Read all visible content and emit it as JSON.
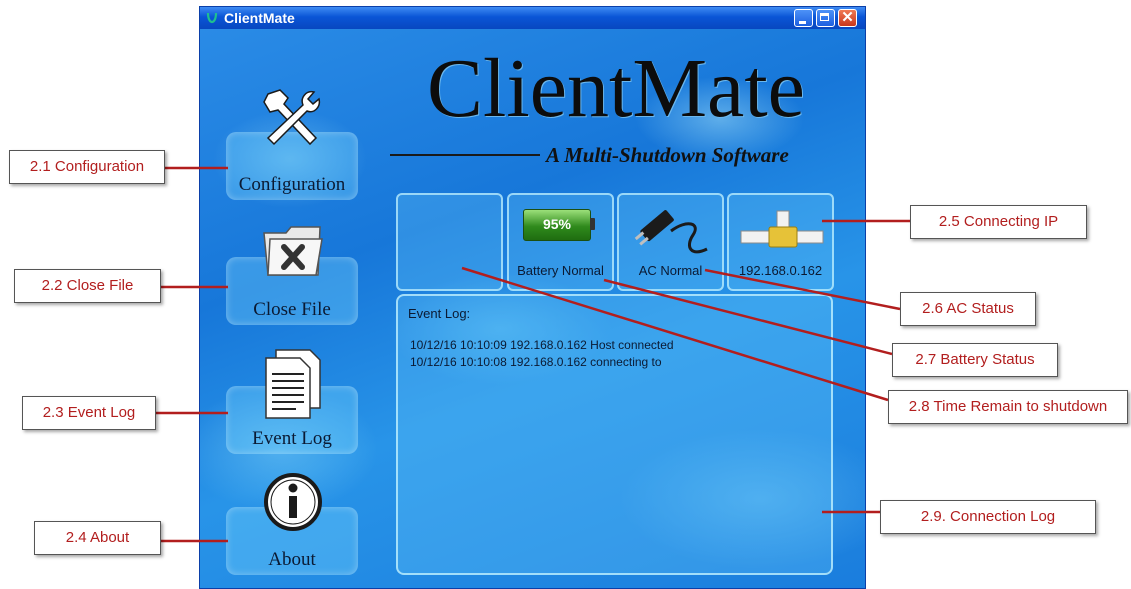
{
  "window": {
    "title": "ClientMate",
    "controls": {
      "minimize_icon": "minimize-icon",
      "maximize_icon": "maximize-icon",
      "close_glyph": "✕"
    }
  },
  "nav": [
    {
      "label": "Configuration",
      "icon": "tools-icon"
    },
    {
      "label": "Close File",
      "icon": "close-file-icon"
    },
    {
      "label": "Event Log",
      "icon": "document-icon"
    },
    {
      "label": "About",
      "icon": "info-icon"
    }
  ],
  "logo": {
    "title": "ClientMate",
    "subtitle": "A Multi-Shutdown Software"
  },
  "status": {
    "time_remain": "",
    "battery": {
      "value": "95%",
      "label": "Battery Normal",
      "level": 0.95,
      "icon": "battery-icon"
    },
    "ac": {
      "label": "AC Normal",
      "icon": "ac-plug-icon"
    },
    "connection": {
      "label": "192.168.0.162",
      "icon": "network-pipe-icon"
    }
  },
  "event_log": {
    "title": "Event Log:",
    "entries": [
      "10/12/16 10:10:09 192.168.0.162 Host connected",
      "10/12/16 10:10:08 192.168.0.162 connecting to"
    ]
  },
  "annotations": [
    "2.1 Configuration",
    "2.2 Close File",
    "2.3 Event Log",
    "2.4 About",
    "2.5 Connecting IP",
    "2.6 AC Status",
    "2.7 Battery Status",
    "2.8 Time Remain to shutdown",
    "2.9. Connection Log"
  ],
  "colors": {
    "annotation_line": "#b21e1e",
    "window_blue": "#1f6fd8",
    "title_bar": "#0a55d6"
  }
}
